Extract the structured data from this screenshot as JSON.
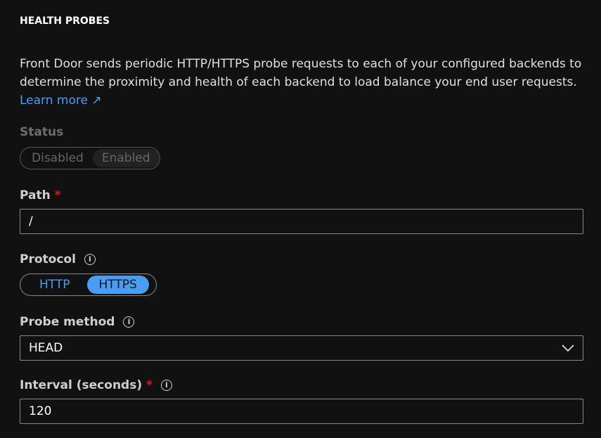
{
  "section_title": "HEALTH PROBES",
  "description": "Front Door sends periodic HTTP/HTTPS probe requests to each of your configured backends to determine the proximity and health of each backend to load balance your end user requests. ",
  "learn_more": "Learn more",
  "status": {
    "label": "Status",
    "options": [
      "Disabled",
      "Enabled"
    ],
    "selected": "Enabled",
    "disabled": true
  },
  "path": {
    "label": "Path",
    "required": "*",
    "value": "/"
  },
  "protocol": {
    "label": "Protocol",
    "options": [
      "HTTP",
      "HTTPS"
    ],
    "selected": "HTTPS"
  },
  "probe_method": {
    "label": "Probe method",
    "value": "HEAD"
  },
  "interval": {
    "label": "Interval (seconds)",
    "required": "*",
    "value": "120"
  },
  "colors": {
    "accent": "#479ef5",
    "required": "#e81123"
  }
}
